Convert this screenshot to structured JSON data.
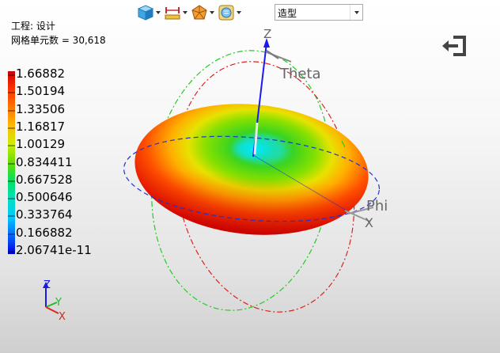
{
  "toolbar": {
    "view_select": {
      "value": "造型"
    },
    "buttons": [
      {
        "name": "view-cube-icon"
      },
      {
        "name": "measure-icon"
      },
      {
        "name": "render-mode-icon"
      },
      {
        "name": "display-settings-icon"
      }
    ]
  },
  "info": {
    "project": "工程: 设计",
    "mesh_elements": "网格单元数 = 30,618"
  },
  "legend": {
    "labels": [
      "1.66882",
      "1.50194",
      "1.33506",
      "1.16817",
      "1.00129",
      "0.834411",
      "0.667528",
      "0.500646",
      "0.333764",
      "0.166882",
      "2.06741e-11"
    ],
    "colors": [
      "#cc0000",
      "#ff3300",
      "#ff7700",
      "#ffbb00",
      "#ccee00",
      "#66dd00",
      "#00e060",
      "#00e0c0",
      "#00c8ff",
      "#0066ff",
      "#0000dd"
    ]
  },
  "scene": {
    "axis_labels": {
      "z": "Z",
      "theta": "Theta",
      "phi": "Phi",
      "x": "X"
    },
    "triad_labels": {
      "z": "Z",
      "y": "Y",
      "x": "X"
    }
  }
}
